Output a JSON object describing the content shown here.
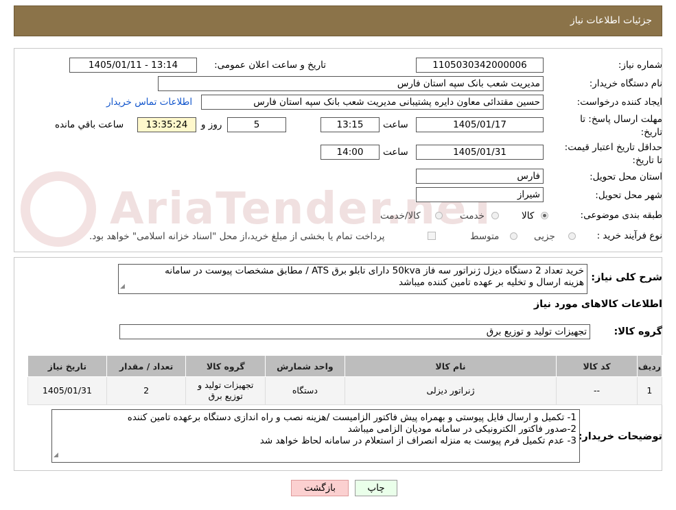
{
  "header": {
    "title": "جزئیات اطلاعات نیاز"
  },
  "watermark": {
    "text": "AriaTender.neT"
  },
  "fields": {
    "need_number": {
      "label": "شماره نیاز:",
      "value": "1105030342000006"
    },
    "announce_datetime": {
      "label": "تاریخ و ساعت اعلان عمومی:",
      "value": "1405/01/11 - 13:14"
    },
    "buyer_org": {
      "label": "نام دستگاه خریدار:",
      "value": "مدیریت شعب بانک سپه استان فارس"
    },
    "requester": {
      "label": "ایجاد کننده درخواست:",
      "value": "حسین مقتدائی معاون  دایره پشتیبانی مدیریت شعب بانک سپه استان فارس",
      "contact_link": "اطلاعات تماس خریدار"
    },
    "response_deadline": {
      "label": "مهلت ارسال پاسخ: تا تاریخ:",
      "date": "1405/01/17",
      "time_label": "ساعت",
      "time": "13:15",
      "days": "5",
      "days_label": "روز و",
      "remaining": "13:35:24",
      "remaining_label": "ساعت باقي مانده"
    },
    "price_validity": {
      "label": "حداقل تاریخ اعتبار قیمت: تا تاریخ:",
      "date": "1405/01/31",
      "time_label": "ساعت",
      "time": "14:00"
    },
    "delivery_province": {
      "label": "استان محل تحویل:",
      "value": "فارس"
    },
    "delivery_city": {
      "label": "شهر محل تحویل:",
      "value": "شیراز"
    },
    "category": {
      "label": "طبقه بندی موضوعی:",
      "options": [
        "کالا",
        "خدمت",
        "کالا/خدمت"
      ],
      "selected": "کالا"
    },
    "process_type": {
      "label": "نوع فرآیند خرید :",
      "options": [
        "جزیی",
        "متوسط"
      ],
      "payment_note": "پرداخت تمام یا بخشی از مبلغ خرید،از محل \"اسناد خزانه اسلامی\" خواهد بود."
    }
  },
  "summary": {
    "label": "شرح کلی نیاز:",
    "line1": "خرید تعداد 2 دستگاه دیزل ژنراتور سه فاز 50kva دارای  تابلو برق  ATS /  مطابق مشخصات پیوست در سامانه",
    "line2": "هزینه ارسال و تخلیه بر عهده تامین کننده میباشد"
  },
  "goods_info": {
    "title": "اطلاعات کالاهای مورد نیاز",
    "group_label": "گروه کالا:",
    "group_value": "تجهیزات تولید و توزیع برق",
    "table": {
      "headers": [
        "ردیف",
        "کد کالا",
        "نام کالا",
        "واحد شمارش",
        "گروه کالا",
        "تعداد / مقدار",
        "تاریخ نیاز"
      ],
      "rows": [
        {
          "row": "1",
          "code": "--",
          "name": "ژنراتور دیزلی",
          "unit": "دستگاه",
          "group": "تجهیزات تولید و توزیع برق",
          "qty": "2",
          "date": "1405/01/31"
        }
      ]
    }
  },
  "buyer_notes": {
    "label": "توضیحات خریدار:",
    "lines": [
      "1-  تکمیل و ارسال فایل پیوستی و بهمراه پیش فاکتور الزامیست /هزینه نصب و راه اندازی دستگاه برعهده تامین کننده",
      "2-صدور فاکتور الکترونیکی در سامانه مودیان الزامی میباشد",
      "3- عدم تکمیل فرم پیوست به منزله انصراف از استعلام در سامانه لحاظ خواهد شد"
    ]
  },
  "buttons": {
    "print": "چاپ",
    "back": "بازگشت"
  },
  "colors": {
    "header_bg": "#8b7349",
    "link": "#1155cc",
    "timer_bg": "#fff8cc",
    "back_button_bg": "#fbd0d0",
    "print_button_bg": "#eaffea"
  }
}
